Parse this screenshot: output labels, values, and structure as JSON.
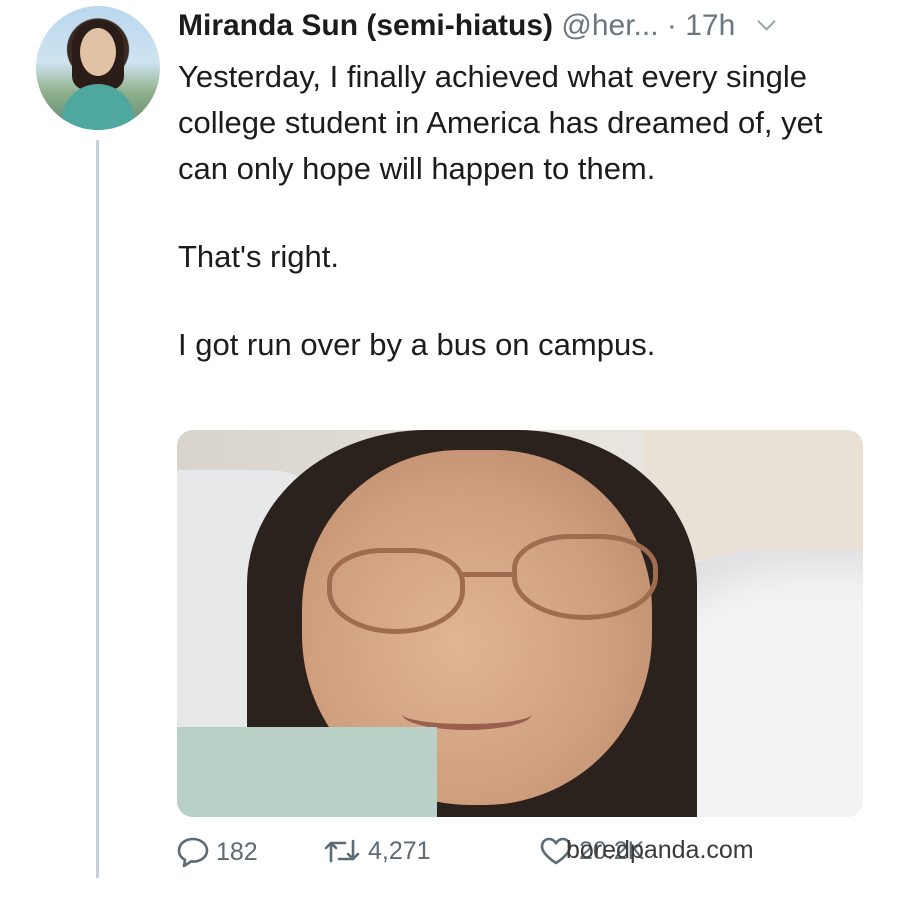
{
  "tweet": {
    "author_name": "Miranda Sun (semi-hiatus)",
    "handle_time": "@her... · 17h",
    "paragraphs": [
      "Yesterday, I finally achieved what every single college student in America has dreamed of, yet can only hope will happen to them.",
      "That's right.",
      "I got run over by a bus on campus."
    ],
    "actions": {
      "replies": "182",
      "retweets": "4,271",
      "likes": "20.2K"
    }
  },
  "watermark": "boredpanda.com",
  "icons": {
    "menu": "chevron-down-icon",
    "reply": "reply-icon",
    "retweet": "retweet-icon",
    "like": "heart-icon"
  }
}
